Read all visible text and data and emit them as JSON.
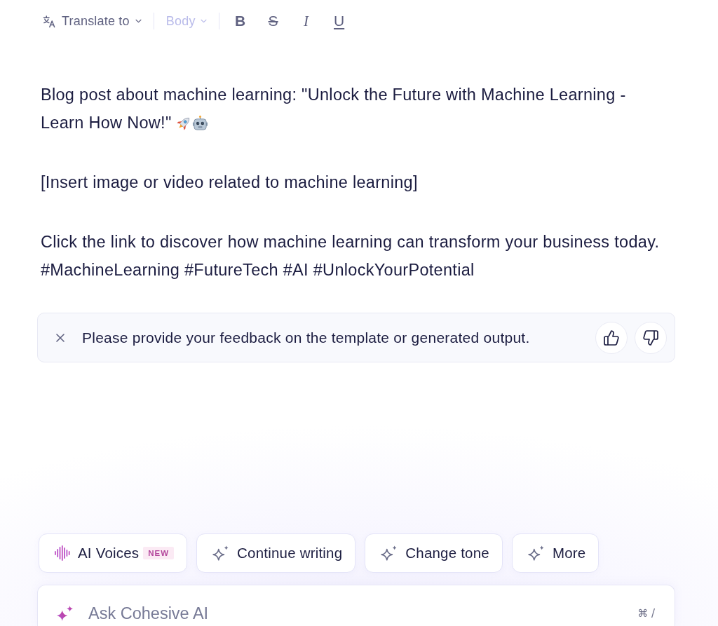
{
  "toolbar": {
    "translate": {
      "label": "Translate to"
    },
    "style_select": {
      "label": "Body",
      "disabled": true
    },
    "format_buttons": [
      {
        "kind": "bold",
        "label": "B"
      },
      {
        "kind": "strikethrough",
        "label": "S"
      },
      {
        "kind": "italic",
        "label": "I"
      },
      {
        "kind": "underline",
        "label": "U"
      }
    ]
  },
  "document": {
    "paragraphs": [
      {
        "lines": [
          "Blog post about machine learning: \"Unlock the Future with Machine Learning -",
          "Learn How Now!\""
        ],
        "emojis": [
          {
            "kind": "rocket"
          },
          {
            "kind": "robot"
          }
        ]
      },
      {
        "lines": [
          "[Insert image or video related to machine learning]"
        ]
      },
      {
        "lines": [
          "Click the link to discover how machine learning can transform your business today.",
          "#MachineLearning #FutureTech #AI #UnlockYourPotential"
        ]
      }
    ]
  },
  "feedback": {
    "message": "Please provide your feedback on the template or generated output."
  },
  "actions": [
    {
      "kind": "voices",
      "label": "AI Voices",
      "badge": "NEW"
    },
    {
      "kind": "sparkle",
      "label": "Continue writing"
    },
    {
      "kind": "sparkle",
      "label": "Change tone"
    },
    {
      "kind": "sparkle",
      "label": "More"
    }
  ],
  "ask": {
    "placeholder": "Ask Cohesive AI",
    "shortcut": "⌘ /"
  }
}
